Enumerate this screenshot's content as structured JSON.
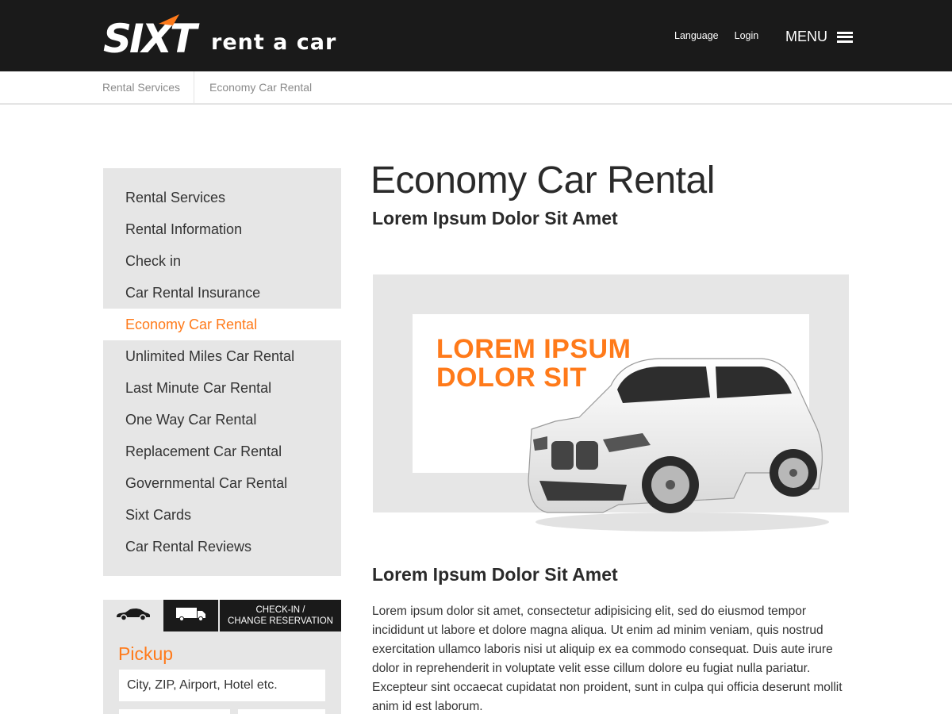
{
  "header": {
    "brand": "SIXT",
    "tagline": "rent a car",
    "links": [
      "Language",
      "Login"
    ],
    "menu_label": "MENU"
  },
  "breadcrumb": [
    "Rental Services",
    "Economy Car Rental"
  ],
  "sidebar": {
    "items": [
      {
        "label": "Rental Services"
      },
      {
        "label": "Rental Information"
      },
      {
        "label": "Check in"
      },
      {
        "label": "Car Rental Insurance"
      },
      {
        "label": "Economy Car Rental",
        "active": true
      },
      {
        "label": "Unlimited Miles Car Rental"
      },
      {
        "label": "Last Minute Car Rental"
      },
      {
        "label": "One Way Car Rental"
      },
      {
        "label": "Replacement Car Rental"
      },
      {
        "label": "Governmental Car Rental"
      },
      {
        "label": "Sixt Cards"
      },
      {
        "label": "Car Rental Reviews"
      }
    ]
  },
  "booking": {
    "tabs": [
      {
        "icon": "car-icon",
        "label": ""
      },
      {
        "icon": "truck-icon",
        "label": ""
      },
      {
        "label_line1": "CHECK-IN /",
        "label_line2": "CHANGE RESERVATION"
      }
    ],
    "pickup_label": "Pickup",
    "pickup_placeholder": "City, ZIP, Airport, Hotel etc."
  },
  "main": {
    "title": "Economy Car Rental",
    "subtitle": "Lorem Ipsum Dolor Sit Amet",
    "banner": {
      "line1": "LOREM IPSUM",
      "line2": "DOLOR SIT"
    },
    "section_title": "Lorem Ipsum Dolor Sit Amet",
    "body": "Lorem ipsum dolor sit amet, consectetur adipisicing elit, sed do eiusmod tempor incididunt ut labore et dolore magna aliqua. Ut enim ad minim veniam, quis nostrud exercitation ullamco laboris nisi ut aliquip ex ea commodo consequat. Duis aute irure dolor in reprehenderit in voluptate velit esse cillum dolore eu fugiat nulla pariatur. Excepteur sint occaecat cupidatat non proident, sunt in culpa qui officia deserunt mollit anim id est laborum."
  },
  "colors": {
    "accent": "#ff7a1a",
    "header_bg": "#1a1a1a",
    "panel_bg": "#e6e6e6"
  }
}
